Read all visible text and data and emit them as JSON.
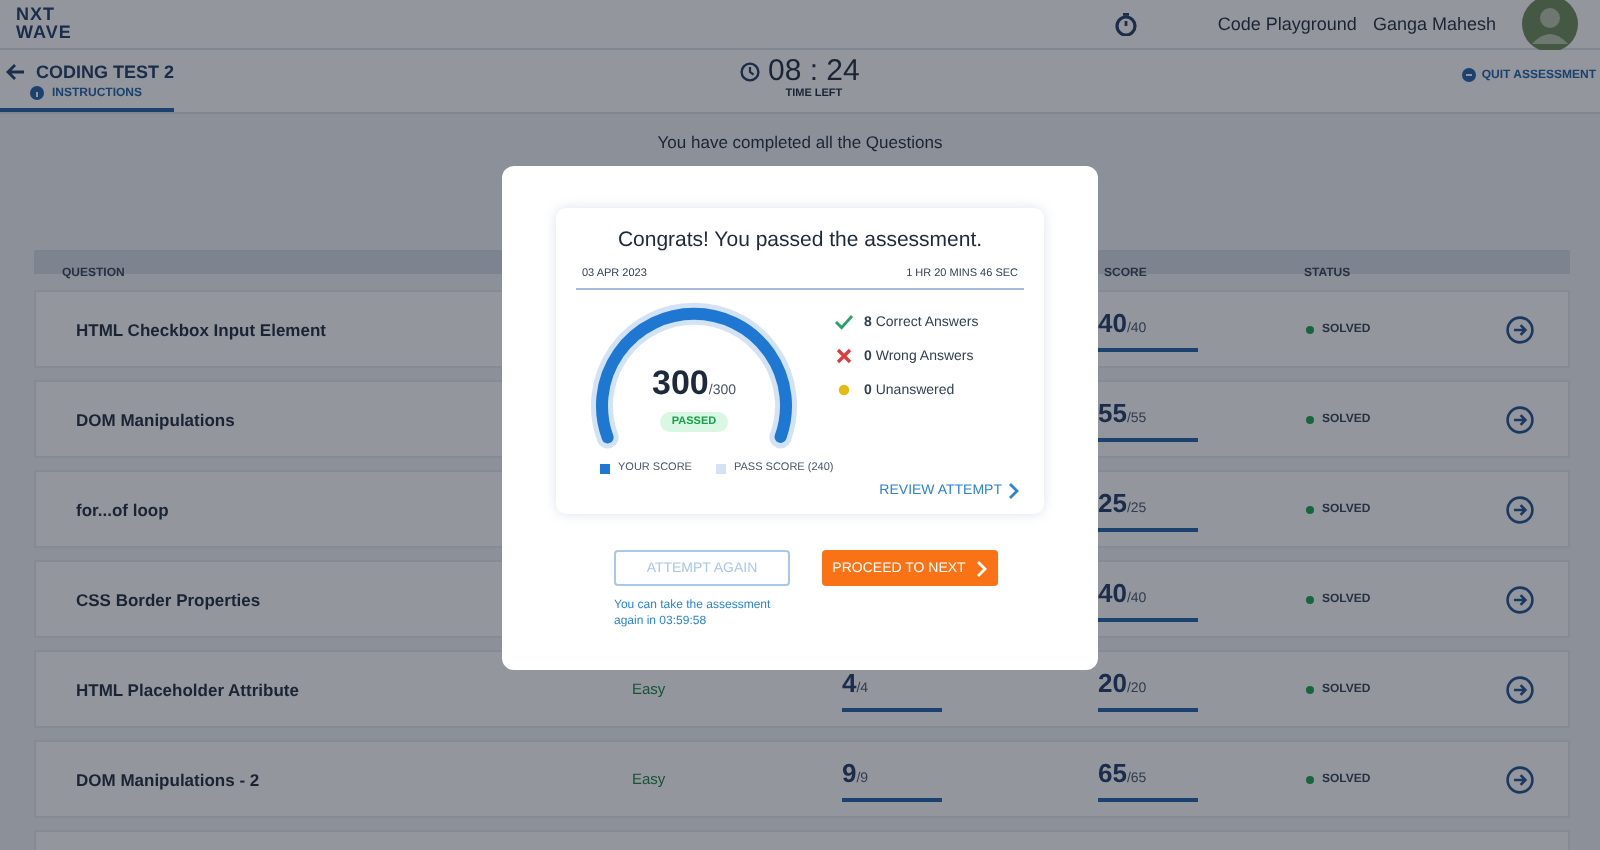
{
  "header": {
    "logo": [
      "NXT",
      "WAVE"
    ],
    "link": "Code Playground",
    "user": "Ganga Mahesh"
  },
  "test": {
    "title": "CODING TEST 2",
    "tabs": [
      {
        "label": "INSTRUCTIONS",
        "selected": true
      }
    ],
    "timer": "08 : 24",
    "timer_label": "TIME LEFT",
    "quit": "QUIT ASSESSMENT"
  },
  "completed_message": "You have completed all the Questions",
  "table": {
    "columns": {
      "question": "QUESTION",
      "score": "SCORE",
      "status": "STATUS"
    },
    "rows": [
      {
        "question": "HTML Checkbox Input Element",
        "score": "40",
        "score_total": "/40",
        "score_bar": {
          "level": 1
        },
        "status": "SOLVED"
      },
      {
        "question": "DOM Manipulations",
        "score": "55",
        "score_total": "/55",
        "score_bar": {
          "level": 1
        },
        "status": "SOLVED"
      },
      {
        "question": "for...of loop",
        "score": "25",
        "score_total": "/25",
        "score_bar": {
          "level": 1
        },
        "status": "SOLVED"
      },
      {
        "question": "CSS Border Properties",
        "score": "40",
        "score_total": "/40",
        "score_bar": {
          "level": 1
        },
        "status": "SOLVED"
      },
      {
        "question": "HTML Placeholder Attribute",
        "difficulty": "Easy",
        "tests": "4",
        "tests_total": "/4",
        "tests_bar": {
          "level": 1
        },
        "score": "20",
        "score_total": "/20",
        "score_bar": {
          "level": 1
        },
        "status": "SOLVED"
      },
      {
        "question": "DOM Manipulations - 2",
        "difficulty": "Easy",
        "tests": "9",
        "tests_total": "/9",
        "tests_bar": {
          "level": 1
        },
        "score": "65",
        "score_total": "/65",
        "score_bar": {
          "level": 1
        },
        "status": "SOLVED"
      }
    ]
  },
  "result_modal": {
    "title": "Congrats! You passed the assessment.",
    "date": "03 APR 2023",
    "duration": "1 HR 20 MINS 46 SEC",
    "score": {
      "value": "300",
      "total": "/300",
      "level": 1,
      "badge": "PASSED"
    },
    "stats": [
      {
        "kind": "correct",
        "count": "8",
        "label": "Correct Answers"
      },
      {
        "kind": "wrong",
        "count": "0",
        "label": "Wrong Answers"
      },
      {
        "kind": "unanswered",
        "count": "0",
        "label": "Unanswered"
      }
    ],
    "legend": [
      {
        "label": "YOUR SCORE",
        "color": "#1e78d2"
      },
      {
        "label": "PASS SCORE (240)",
        "color": "#d3e3f5"
      }
    ],
    "review_link": "REVIEW ATTEMPT",
    "buttons": [
      {
        "kind": "outline",
        "label": "ATTEMPT AGAIN",
        "disabled": true
      },
      {
        "kind": "primary",
        "label": "PROCEED TO NEXT",
        "disabled": false
      }
    ],
    "retake_note": "You can take the assessment again in 03:59:58"
  }
}
